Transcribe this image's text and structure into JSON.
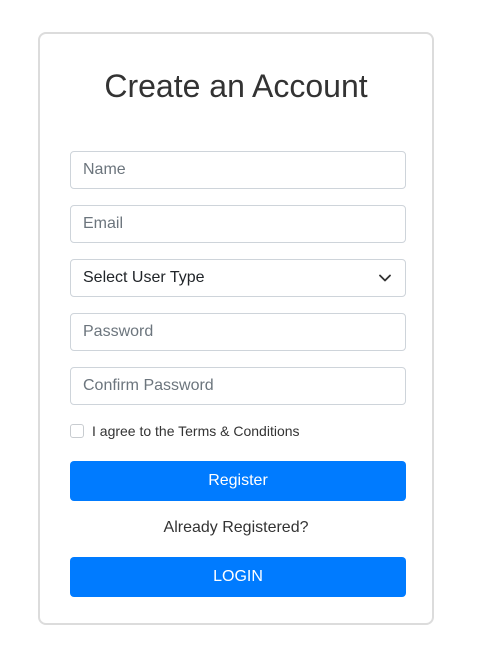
{
  "form": {
    "title": "Create an Account",
    "name_placeholder": "Name",
    "email_placeholder": "Email",
    "user_type_selected": "Select User Type",
    "password_placeholder": "Password",
    "confirm_password_placeholder": "Confirm Password",
    "terms_label": "I agree to the Terms & Conditions",
    "register_label": "Register",
    "already_registered": "Already Registered?",
    "login_label": "LOGIN"
  },
  "icons": {
    "select_arrow": "chevron-down-icon"
  },
  "colors": {
    "primary": "#007bff",
    "border": "#ced4da",
    "card_border": "#dcdcdc",
    "text": "#333333"
  }
}
